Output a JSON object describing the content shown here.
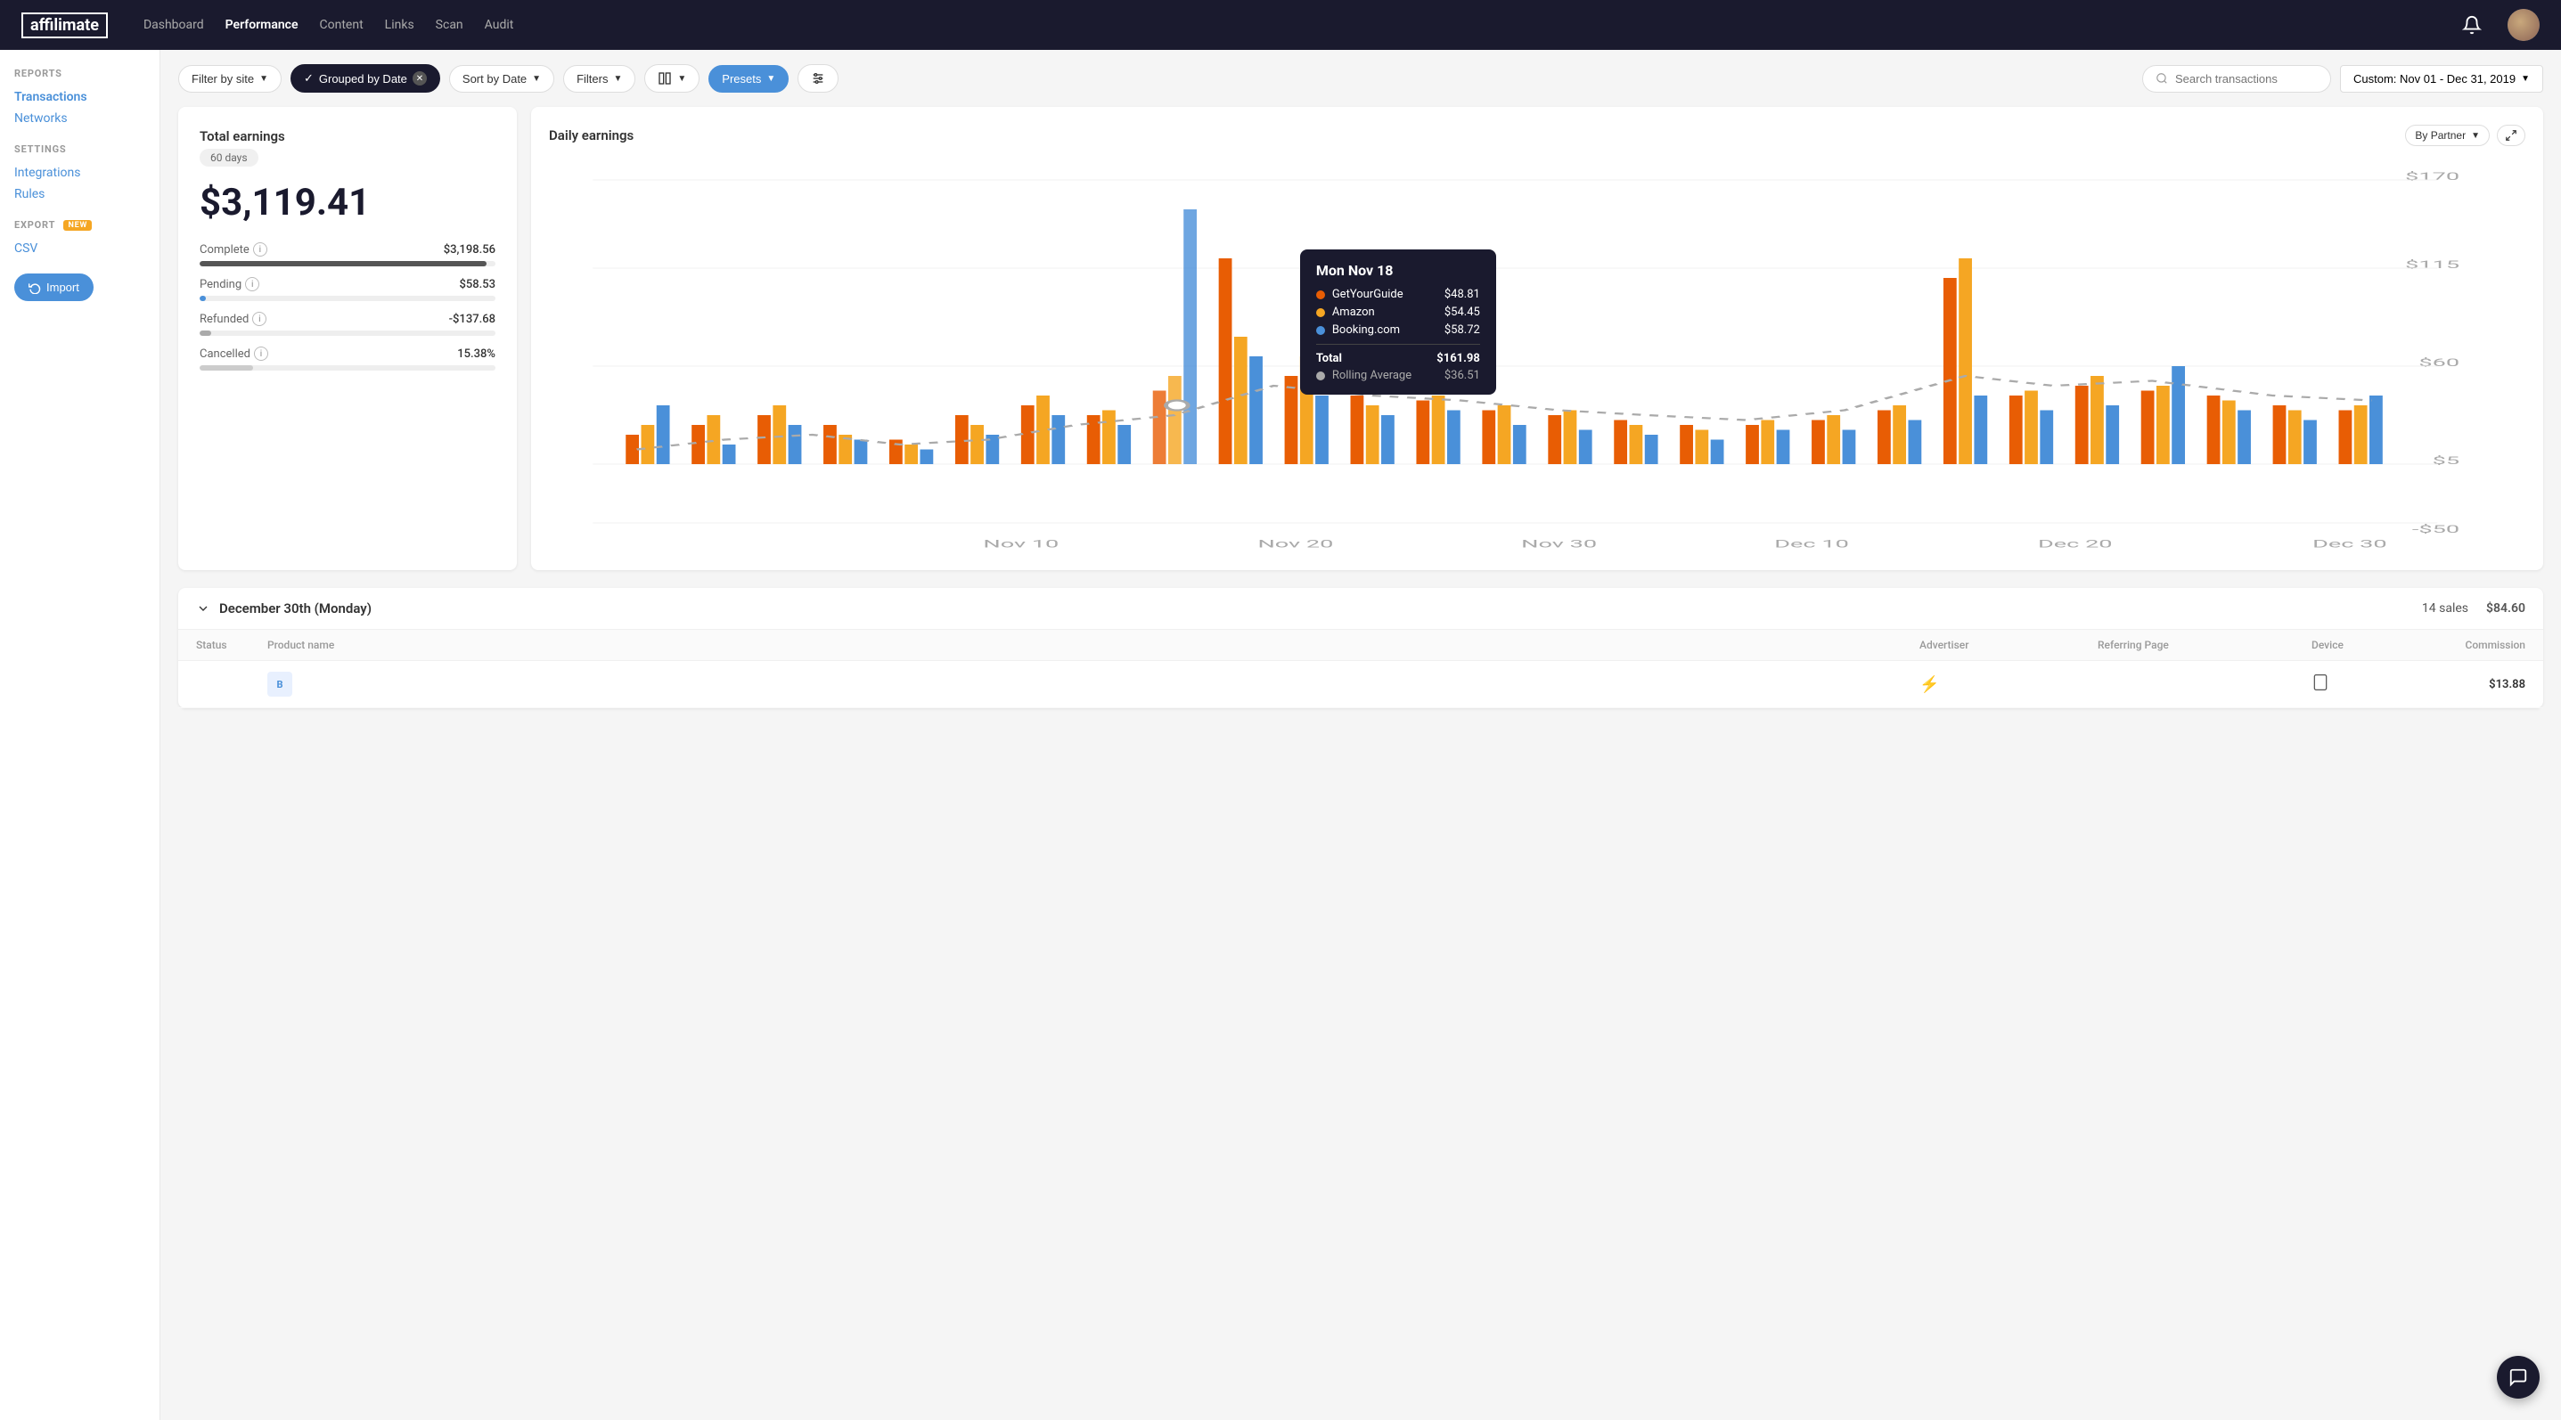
{
  "app": {
    "logo": "affilimate",
    "nav": [
      {
        "label": "Dashboard",
        "active": false
      },
      {
        "label": "Performance",
        "active": true
      },
      {
        "label": "Content",
        "active": false
      },
      {
        "label": "Links",
        "active": false
      },
      {
        "label": "Scan",
        "active": false
      },
      {
        "label": "Audit",
        "active": false
      }
    ]
  },
  "sidebar": {
    "reports_label": "REPORTS",
    "transactions_label": "Transactions",
    "networks_label": "Networks",
    "settings_label": "SETTINGS",
    "integrations_label": "Integrations",
    "rules_label": "Rules",
    "export_label": "EXPORT",
    "export_badge": "NEW",
    "csv_label": "CSV",
    "import_label": "Import"
  },
  "toolbar": {
    "filter_by_site": "Filter by site",
    "grouped_by_date": "Grouped by Date",
    "sort_by_date": "Sort by Date",
    "filters": "Filters",
    "columns_icon": "⊞",
    "presets": "Presets",
    "search_placeholder": "Search transactions",
    "date_range": "Custom: Nov 01 - Dec 31, 2019"
  },
  "earnings_card": {
    "title": "Total earnings",
    "days": "60 days",
    "total": "$3,119.41",
    "stats": [
      {
        "label": "Complete",
        "value": "$3,198.56",
        "percent": 97,
        "color": "#555"
      },
      {
        "label": "Pending",
        "value": "$58.53",
        "percent": 2,
        "color": "#4a90d9"
      },
      {
        "label": "Refunded",
        "value": "-$137.68",
        "percent": 3,
        "color": "#aaa"
      },
      {
        "label": "Cancelled",
        "value": "15.38%",
        "percent": 18,
        "color": "#ccc"
      }
    ]
  },
  "chart": {
    "title": "Daily earnings",
    "by_partner_label": "By Partner",
    "y_labels": [
      "$170",
      "$115",
      "$60",
      "$5",
      "-$50"
    ],
    "x_labels": [
      "Nov 10",
      "Nov 20",
      "Nov 30",
      "Dec 10",
      "Dec 20",
      "Dec 30"
    ],
    "tooltip": {
      "date": "Mon Nov 18",
      "rows": [
        {
          "label": "GetYourGuide",
          "value": "$48.81",
          "color": "#e85d04"
        },
        {
          "label": "Amazon",
          "value": "$54.45",
          "color": "#f5a623"
        },
        {
          "label": "Booking.com",
          "value": "$58.72",
          "color": "#4a90d9"
        }
      ],
      "total_label": "Total",
      "total_value": "$161.98",
      "avg_label": "Rolling Average",
      "avg_value": "$36.51",
      "avg_color": "#aaa"
    }
  },
  "transactions": {
    "group_date": "December 30th (Monday)",
    "sales_count": "14 sales",
    "commission": "$84.60",
    "table_headers": {
      "status": "Status",
      "product": "Product name",
      "advertiser": "Advertiser",
      "referring": "Referring Page",
      "device": "Device",
      "commission": "Commission"
    },
    "row": {
      "status_color": "#4caf50",
      "product_label": "B",
      "advertiser_icon": "⚡",
      "device_icon": "tablet",
      "commission": "$13.88"
    }
  }
}
